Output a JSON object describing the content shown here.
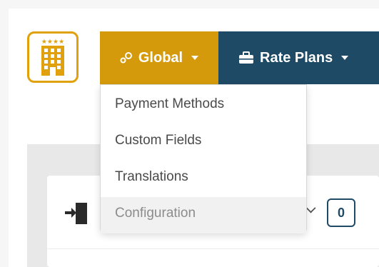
{
  "nav": {
    "global": {
      "label": "Global",
      "icon": "settings-nodes-icon"
    },
    "rate_plans": {
      "label": "Rate Plans",
      "icon": "briefcase-icon"
    },
    "colors": {
      "global_bg": "#d49a0b",
      "rate_bg": "#1f4a66",
      "logo_gold": "#e0a10c"
    }
  },
  "logo": {
    "icon": "hotel-building-icon"
  },
  "dropdown": {
    "items": [
      {
        "label": "Payment Methods"
      },
      {
        "label": "Custom Fields"
      },
      {
        "label": "Translations"
      },
      {
        "label": "Configuration",
        "state": "muted"
      }
    ]
  },
  "card": {
    "icon": "login-door-icon",
    "count": "0"
  }
}
